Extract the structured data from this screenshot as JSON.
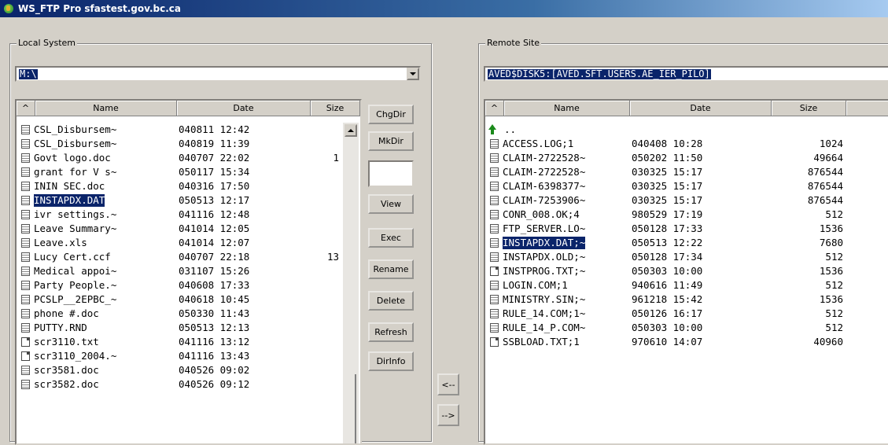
{
  "window": {
    "title": "WS_FTP Pro sfastest.gov.bc.ca"
  },
  "local": {
    "group_label": "Local System",
    "path": "M:\\",
    "columns": {
      "sort": "^",
      "name": "Name",
      "date": "Date",
      "size": "Size"
    },
    "files": [
      {
        "name": "CSL_Disbursem~",
        "date": "040811 12:42",
        "size": "",
        "icon": "doc"
      },
      {
        "name": "CSL_Disbursem~",
        "date": "040819 11:39",
        "size": "",
        "icon": "doc"
      },
      {
        "name": "Govt logo.doc",
        "date": "040707 22:02",
        "size": "1",
        "icon": "doc"
      },
      {
        "name": "grant for V s~",
        "date": "050117 15:34",
        "size": "",
        "icon": "doc"
      },
      {
        "name": "ININ SEC.doc",
        "date": "040316 17:50",
        "size": "",
        "icon": "doc"
      },
      {
        "name": "INSTAPDX.DAT",
        "date": "050513 12:17",
        "size": "",
        "icon": "doc",
        "selected": true
      },
      {
        "name": "ivr settings.~",
        "date": "041116 12:48",
        "size": "",
        "icon": "doc"
      },
      {
        "name": "Leave Summary~",
        "date": "041014 12:05",
        "size": "",
        "icon": "doc"
      },
      {
        "name": "Leave.xls",
        "date": "041014 12:07",
        "size": "",
        "icon": "doc"
      },
      {
        "name": "Lucy Cert.ccf",
        "date": "040707 22:18",
        "size": "13",
        "icon": "doc"
      },
      {
        "name": "Medical appoi~",
        "date": "031107 15:26",
        "size": "",
        "icon": "doc"
      },
      {
        "name": "Party People.~",
        "date": "040608 17:33",
        "size": "",
        "icon": "doc"
      },
      {
        "name": "PCSLP__2EPBC_~",
        "date": "040618 10:45",
        "size": "",
        "icon": "doc"
      },
      {
        "name": "phone #.doc",
        "date": "050330 11:43",
        "size": "",
        "icon": "doc"
      },
      {
        "name": "PUTTY.RND",
        "date": "050513 12:13",
        "size": "",
        "icon": "doc"
      },
      {
        "name": "scr3110.txt",
        "date": "041116 13:12",
        "size": "",
        "icon": "txt"
      },
      {
        "name": "scr3110_2004.~",
        "date": "041116 13:43",
        "size": "",
        "icon": "txt"
      },
      {
        "name": "scr3581.doc",
        "date": "040526 09:02",
        "size": "",
        "icon": "doc"
      },
      {
        "name": "scr3582.doc",
        "date": "040526 09:12",
        "size": "",
        "icon": "doc"
      }
    ]
  },
  "buttons": {
    "chgdir": "ChgDir",
    "mkdir": "MkDir",
    "view": "View",
    "exec": "Exec",
    "rename": "Rename",
    "delete": "Delete",
    "refresh": "Refresh",
    "dirinfo": "DirInfo",
    "upload": "<--",
    "download": "-->"
  },
  "remote": {
    "group_label": "Remote Site",
    "path": "AVED$DISK5:[AVED.SFT.USERS.AE_IER_PILO]",
    "columns": {
      "sort": "^",
      "name": "Name",
      "date": "Date",
      "size": "Size"
    },
    "parent": "..",
    "files": [
      {
        "name": "ACCESS.LOG;1",
        "date": "040408 10:28",
        "size": "1024",
        "icon": "doc"
      },
      {
        "name": "CLAIM-2722528~",
        "date": "050202 11:50",
        "size": "49664",
        "icon": "doc"
      },
      {
        "name": "CLAIM-2722528~",
        "date": "030325 15:17",
        "size": "876544",
        "icon": "doc"
      },
      {
        "name": "CLAIM-6398377~",
        "date": "030325 15:17",
        "size": "876544",
        "icon": "doc"
      },
      {
        "name": "CLAIM-7253906~",
        "date": "030325 15:17",
        "size": "876544",
        "icon": "doc"
      },
      {
        "name": "CONR_008.OK;4",
        "date": "980529 17:19",
        "size": "512",
        "icon": "doc"
      },
      {
        "name": "FTP_SERVER.LO~",
        "date": "050128 17:33",
        "size": "1536",
        "icon": "doc"
      },
      {
        "name": "INSTAPDX.DAT;~",
        "date": "050513 12:22",
        "size": "7680",
        "icon": "doc",
        "selected": true
      },
      {
        "name": "INSTAPDX.OLD;~",
        "date": "050128 17:34",
        "size": "512",
        "icon": "doc"
      },
      {
        "name": "INSTPROG.TXT;~",
        "date": "050303 10:00",
        "size": "1536",
        "icon": "txt"
      },
      {
        "name": "LOGIN.COM;1",
        "date": "940616 11:49",
        "size": "512",
        "icon": "doc"
      },
      {
        "name": "MINISTRY.SIN;~",
        "date": "961218 15:42",
        "size": "1536",
        "icon": "doc"
      },
      {
        "name": "RULE_14.COM;1~",
        "date": "050126 16:17",
        "size": "512",
        "icon": "doc"
      },
      {
        "name": "RULE_14_P.COM~",
        "date": "050303 10:00",
        "size": "512",
        "icon": "doc"
      },
      {
        "name": "SSBLOAD.TXT;1",
        "date": "970610 14:07",
        "size": "40960",
        "icon": "txt"
      }
    ]
  }
}
